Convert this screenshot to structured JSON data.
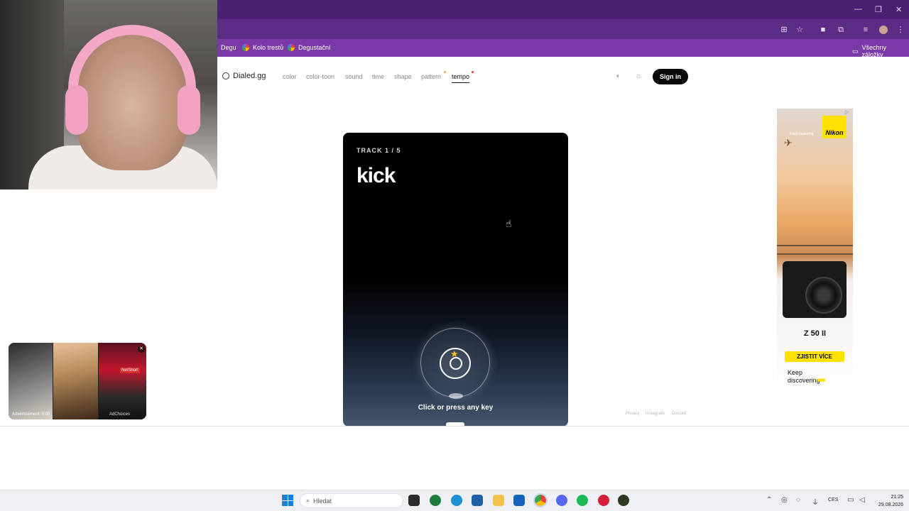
{
  "browser": {
    "bookmarks": [
      "Degu",
      "Kolo trestů",
      "Degustační"
    ],
    "all_bookmarks": "Všechny záložky",
    "window_controls": [
      "minimize-icon",
      "restore-icon",
      "close-icon"
    ]
  },
  "site": {
    "logo": "Dialed.gg",
    "nav": [
      "color",
      "color-toon",
      "sound",
      "time",
      "shape",
      "pattern",
      "tempo"
    ],
    "active_nav": "tempo",
    "signin": "Sign in"
  },
  "game": {
    "track_label": "TRACK 1 / 5",
    "word": "kick",
    "hint": "Click or press any key"
  },
  "footer": {
    "links": [
      "Privacy",
      "Instagram",
      "Discord"
    ]
  },
  "nikon_ad": {
    "brand": "Nikon",
    "tagline_small": "Keep exploring",
    "model": "Z 50 II",
    "cta": "ZJISTIT VÍCE",
    "tagline_line1": "Keep",
    "tagline_line2": "discovering",
    "accent": "#ffe100"
  },
  "video_ad": {
    "brand": "NetShort",
    "label": "Advertisement: 0:09",
    "choices": "AdChoices"
  },
  "taskbar": {
    "search_placeholder": "Hledat",
    "language": "CES",
    "time": "21:25",
    "date": "29.08.2026"
  },
  "colors": {
    "chrome_purple": "#4b1f72",
    "bookmark_bar": "#7a3ba8",
    "card_bg": "#000000",
    "signin_bg": "#0a0a0a"
  }
}
